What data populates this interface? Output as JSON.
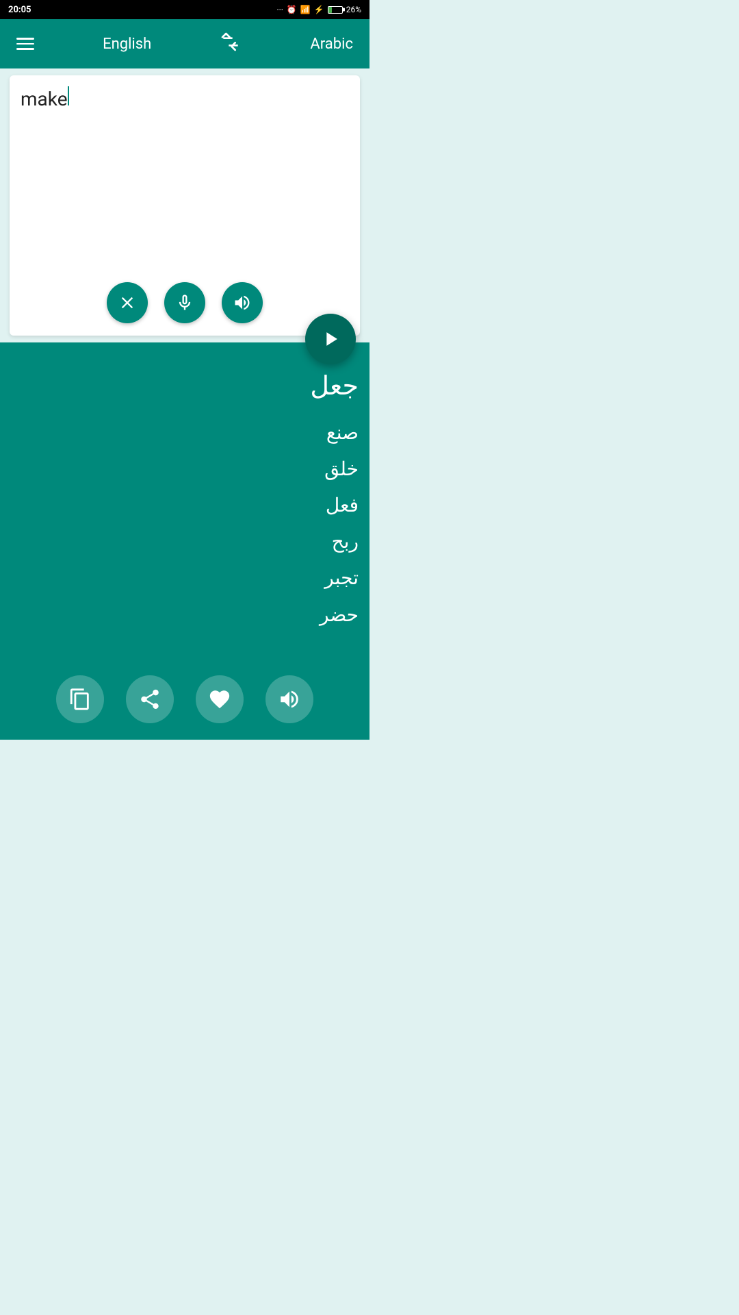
{
  "statusBar": {
    "time": "20:05",
    "battery": "26%"
  },
  "toolbar": {
    "sourceLang": "English",
    "targetLang": "Arabic",
    "swapIcon": "⇄"
  },
  "inputArea": {
    "inputText": "make",
    "placeholder": ""
  },
  "outputArea": {
    "mainTranslation": "جعل",
    "alternatives": "صنع\nخلق\nفعل\nربح\nتجبر\nحضر"
  },
  "inputActions": {
    "clearLabel": "clear",
    "micLabel": "microphone",
    "speakerLabel": "speaker"
  },
  "outputActions": {
    "copyLabel": "copy",
    "shareLabel": "share",
    "favoriteLabel": "favorite",
    "speakLabel": "speak"
  },
  "fabLabel": "translate"
}
